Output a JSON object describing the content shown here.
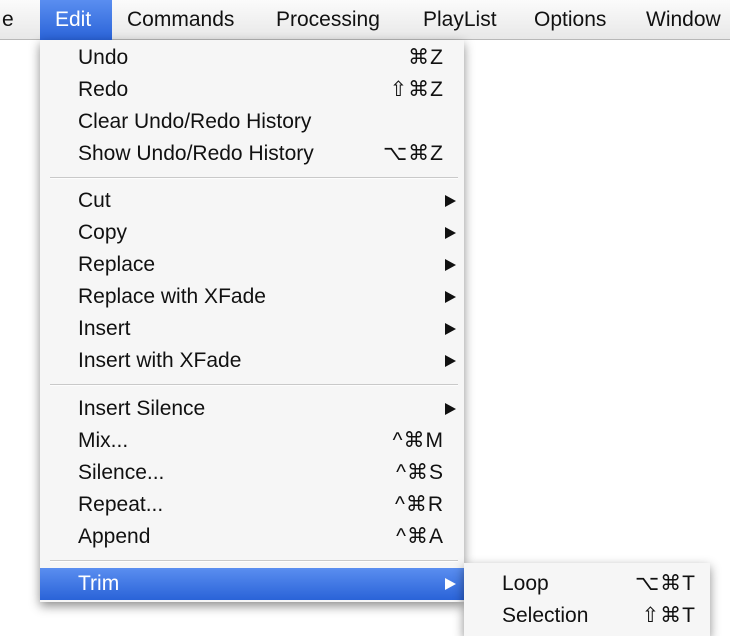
{
  "menubar": {
    "items": [
      {
        "label": "e"
      },
      {
        "label": "Edit"
      },
      {
        "label": "Commands"
      },
      {
        "label": "Processing"
      },
      {
        "label": "PlayList"
      },
      {
        "label": "Options"
      },
      {
        "label": "Window"
      }
    ]
  },
  "edit_menu": {
    "items": [
      {
        "label": "Undo",
        "shortcut": "⌘Z"
      },
      {
        "label": "Redo",
        "shortcut": "⇧⌘Z"
      },
      {
        "label": "Clear Undo/Redo History",
        "shortcut": ""
      },
      {
        "label": "Show Undo/Redo History",
        "shortcut": "⌥⌘Z"
      },
      {
        "label": "Cut"
      },
      {
        "label": "Copy"
      },
      {
        "label": "Replace"
      },
      {
        "label": "Replace with XFade"
      },
      {
        "label": "Insert"
      },
      {
        "label": "Insert with XFade"
      },
      {
        "label": "Insert Silence"
      },
      {
        "label": "Mix...",
        "shortcut": "^⌘M"
      },
      {
        "label": "Silence...",
        "shortcut": "^⌘S"
      },
      {
        "label": "Repeat...",
        "shortcut": "^⌘R"
      },
      {
        "label": "Append",
        "shortcut": "^⌘A"
      },
      {
        "label": "Trim"
      }
    ]
  },
  "trim_submenu": {
    "items": [
      {
        "label": "Loop",
        "shortcut": "⌥⌘T"
      },
      {
        "label": "Selection",
        "shortcut": "⇧⌘T"
      }
    ]
  },
  "colors": {
    "highlight": "#3b73e0",
    "menu_bg": "#f6f6f6"
  }
}
